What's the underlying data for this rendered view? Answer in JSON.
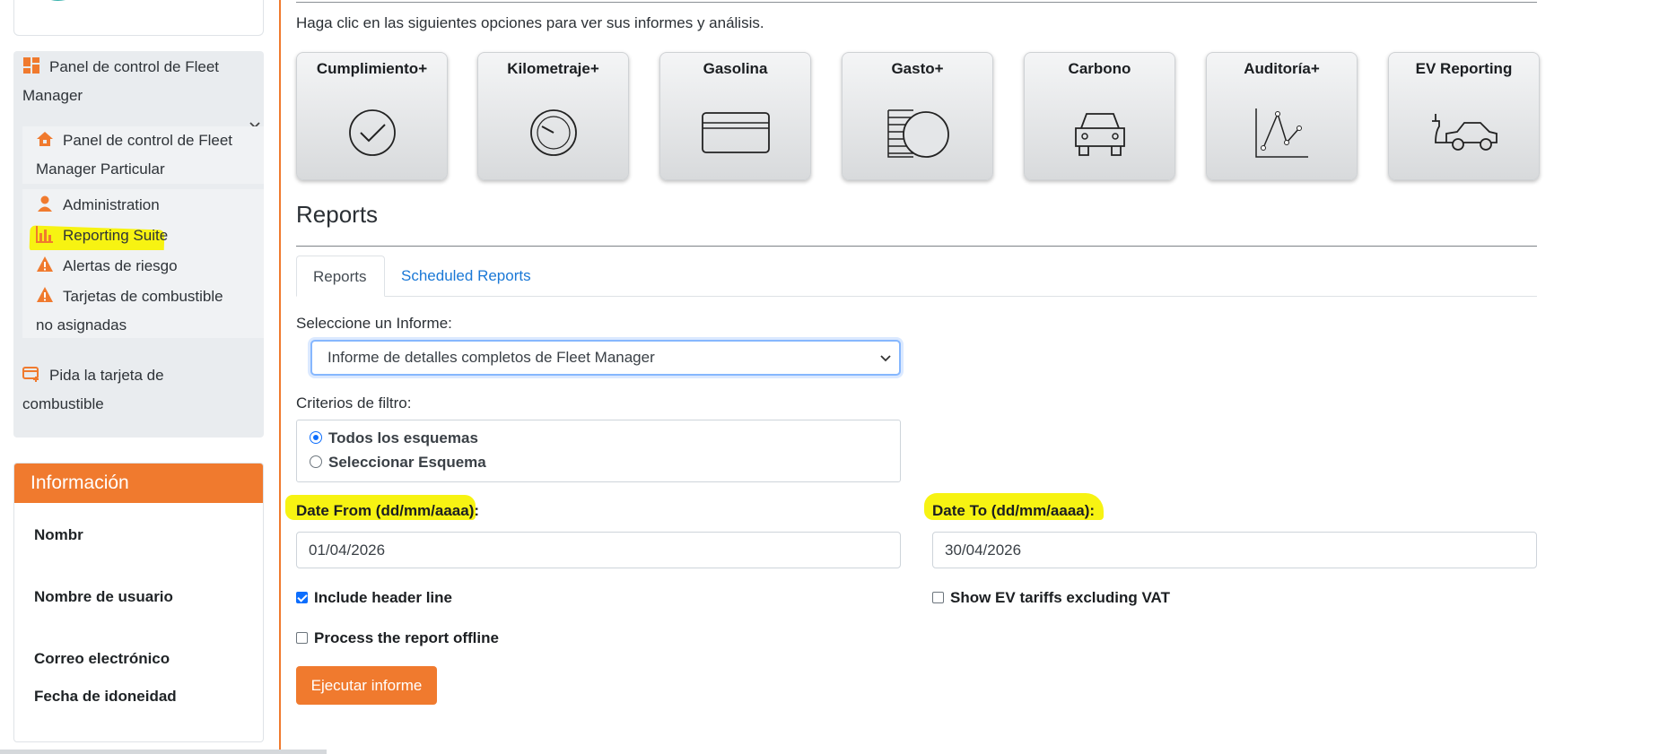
{
  "sidebar": {
    "items": [
      {
        "label": "Panel de control de Fleet Manager",
        "icon": "dashboard-icon"
      },
      {
        "label": "Panel de control de Fleet Manager Particular",
        "icon": "home-icon"
      },
      {
        "label": "Administration",
        "icon": "user-icon"
      },
      {
        "label": "Reporting Suite",
        "icon": "bar-chart-icon"
      },
      {
        "label": "Alertas de riesgo",
        "icon": "warning-icon"
      },
      {
        "label": "Tarjetas de combustible no asignadas",
        "icon": "warning-icon"
      },
      {
        "label": "Pida la tarjeta de combustible",
        "icon": "card-plus-icon"
      }
    ],
    "item0_line1": "Panel de control de Fleet",
    "item0_line2": "Manager",
    "item1_line1": "Panel de control de Fleet",
    "item1_line2": "Manager Particular",
    "item5_line1": "Tarjetas de combustible",
    "item5_line2": "no asignadas",
    "item6_line1": "Pida la tarjeta de",
    "item6_line2": "combustible"
  },
  "info": {
    "title": "Información",
    "fields": [
      "Nombr",
      "Nombre de usuario",
      "Correo electrónico",
      "Fecha de idoneidad"
    ]
  },
  "main": {
    "intro": "Haga clic en las siguientes opciones para ver sus informes y análisis.",
    "tiles": [
      {
        "label": "Cumplimiento+",
        "icon": "check-circle-icon"
      },
      {
        "label": "Kilometraje+",
        "icon": "speedometer-icon"
      },
      {
        "label": "Gasolina",
        "icon": "credit-card-icon"
      },
      {
        "label": "Gasto+",
        "icon": "coins-icon"
      },
      {
        "label": "Carbono",
        "icon": "car-front-icon"
      },
      {
        "label": "Auditoría+",
        "icon": "line-chart-icon"
      },
      {
        "label": "EV Reporting",
        "icon": "ev-car-icon"
      }
    ],
    "section_title": "Reports",
    "tabs": [
      {
        "label": "Reports",
        "active": true
      },
      {
        "label": "Scheduled Reports",
        "active": false
      }
    ],
    "select_label": "Seleccione un Informe:",
    "select_value": "Informe de detalles completos de Fleet Manager",
    "filter_label": "Criterios de filtro:",
    "filter_options": [
      {
        "label": "Todos los esquemas",
        "checked": true
      },
      {
        "label": "Seleccionar Esquema",
        "checked": false
      }
    ],
    "date_from_label": "Date From (dd/mm/aaaa):",
    "date_from_value": "01/04/2026",
    "date_to_label": "Date To (dd/mm/aaaa):",
    "date_to_value": "30/04/2026",
    "checks": [
      {
        "label": "Include header line",
        "checked": true
      },
      {
        "label": "Show EV tariffs excluding VAT",
        "checked": false
      },
      {
        "label": "Process the report offline",
        "checked": false
      }
    ],
    "run_button": "Ejecutar informe"
  },
  "colors": {
    "accent": "#f07a2e",
    "link": "#1a78d6",
    "highlight": "#f7f312"
  }
}
